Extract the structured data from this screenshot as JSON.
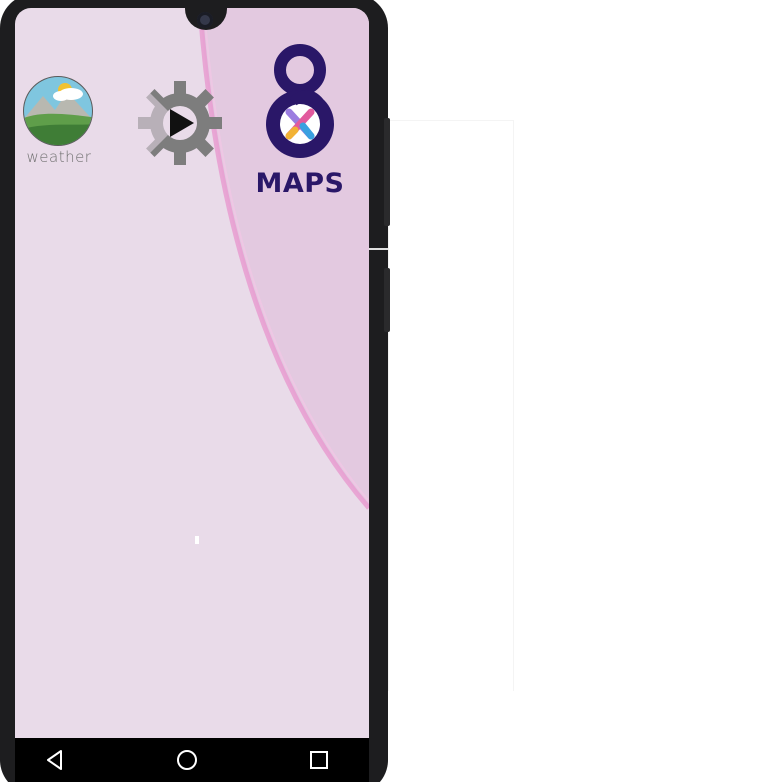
{
  "device": {
    "frame_color": "#1d1d1f",
    "screen_color": "#e9dbe9",
    "accent_curve_color": "#e79cd0"
  },
  "home_screen": {
    "apps": [
      {
        "id": "weather",
        "label": "weather",
        "icon": "weather-landscape-icon"
      },
      {
        "id": "media-settings",
        "label": "",
        "icon": "gear-play-icon"
      },
      {
        "id": "maps",
        "label": "MAPS",
        "icon": "map-pin-icon",
        "brand_color": "#2a1768"
      }
    ]
  },
  "navigation_bar": {
    "buttons": [
      {
        "id": "back",
        "icon": "back-triangle-icon"
      },
      {
        "id": "home",
        "icon": "home-circle-icon"
      },
      {
        "id": "recents",
        "icon": "recents-square-icon"
      }
    ]
  }
}
